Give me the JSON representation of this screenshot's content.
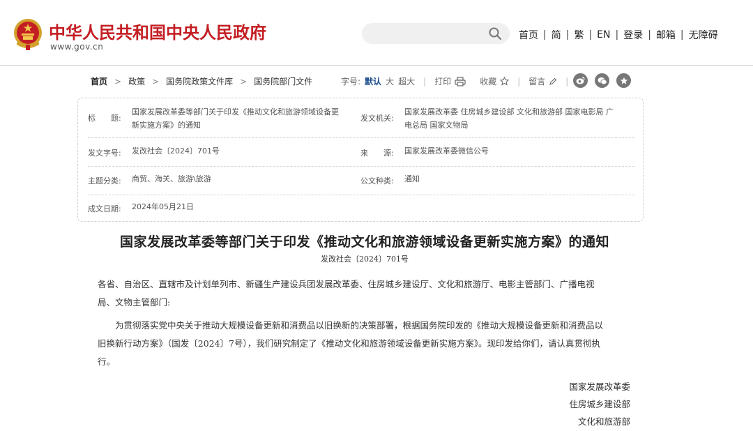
{
  "header": {
    "site_title": "中华人民共和国中央人民政府",
    "site_url": "www.gov.cn",
    "search_placeholder": "",
    "nav": [
      {
        "label": "首页"
      },
      {
        "label": "简"
      },
      {
        "label": "繁"
      },
      {
        "label": "EN"
      },
      {
        "label": "登录"
      },
      {
        "label": "邮箱"
      },
      {
        "label": "无障碍"
      }
    ],
    "nav_separator": "|"
  },
  "breadcrumb": {
    "items": [
      "首页",
      "政策",
      "国务院政策文件库",
      "国务院部门文件"
    ],
    "separator": ">"
  },
  "tools": {
    "font_size_label": "字号:",
    "font_sizes": [
      "默认",
      "大",
      "超大"
    ],
    "active_font_size": "默认",
    "print_label": "打印",
    "favorite_label": "收藏",
    "comment_label": "留言"
  },
  "share": {
    "icons": [
      "weibo-icon",
      "wechat-icon",
      "star-icon"
    ],
    "color": "#777777"
  },
  "info": {
    "title_label": "标　　题:",
    "title_line1": "国家发展改革委等部门关于印发《推动文化和旅游领域设备更",
    "title_line2": "新实施方案》的通知",
    "issuer_label": "发文机关:",
    "issuer_line1": "国家发展改革委 住房城乡建设部 文化和旅游部 国家电影局 广",
    "issuer_line2": "电总局 国家文物局",
    "docno_label": "发文字号:",
    "docno_value": "发改社会〔2024〕701号",
    "source_label": "来　　源:",
    "source_value": "国家发展改革委微信公号",
    "topic_label": "主题分类:",
    "topic_value": "商贸、海关、旅游\\旅游",
    "doctype_label": "公文种类:",
    "doctype_value": "通知",
    "date_label": "成文日期:",
    "date_value": "2024年05月21日"
  },
  "article": {
    "title": "国家发展改革委等部门关于印发《推动文化和旅游领域设备更新实施方案》的通知",
    "doc_number": "发改社会〔2024〕701号",
    "addressee_line1": "各省、自治区、直辖市及计划单列市、新疆生产建设兵团发展改革委、住房城乡建设厅、文化和旅游厅、电影主管部门、广播电视",
    "addressee_line2": "局、文物主管部门:",
    "body_line1": "　　为贯彻落实党中央关于推动大规模设备更新和消费品以旧换新的决策部署，根据国务院印发的《推动大规模设备更新和消费品以",
    "body_line2": "旧换新行动方案》（国发〔2024〕7号），我们研究制定了《推动文化和旅游领域设备更新实施方案》。现印发给你们，请认真贯彻执",
    "body_line3": "行。",
    "signatures": [
      "国家发展改革委",
      "住房城乡建设部",
      "文化和旅游部"
    ]
  },
  "colors": {
    "brand_red": "#c31e23",
    "link_blue": "#1e4f8f"
  }
}
